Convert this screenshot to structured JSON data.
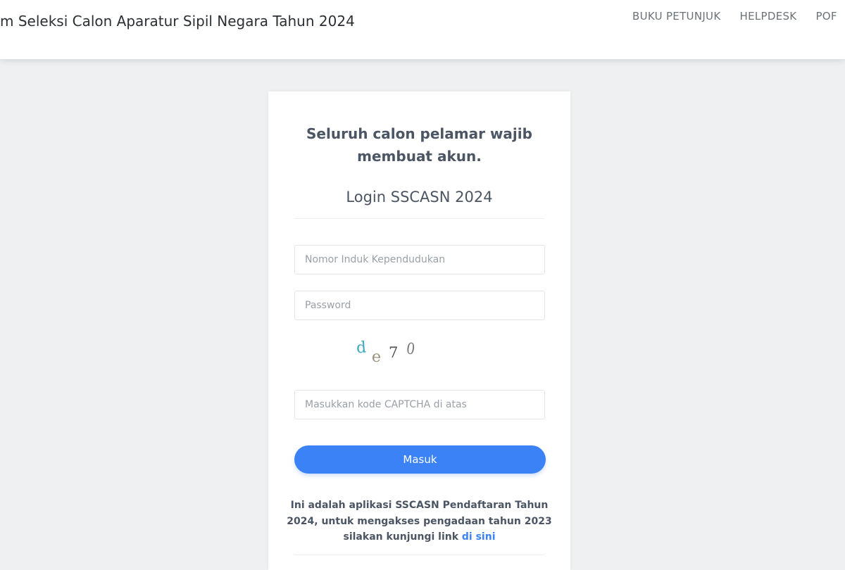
{
  "header": {
    "title": "m Seleksi Calon Aparatur Sipil Negara Tahun 2024",
    "nav": [
      {
        "label": "BUKU PETUNJUK"
      },
      {
        "label": "HELPDESK"
      },
      {
        "label": "POF"
      }
    ]
  },
  "login": {
    "headline_line1": "Seluruh calon pelamar wajib",
    "headline_line2": "membuat akun.",
    "subtitle": "Login SSCASN 2024",
    "nik_placeholder": "Nomor Induk Kependudukan",
    "password_placeholder": "Password",
    "captcha": {
      "chars": [
        {
          "char": "d",
          "color": "#3aa8c4"
        },
        {
          "char": "e",
          "color": "#9b8f7d"
        },
        {
          "char": "7",
          "color": "#555555"
        },
        {
          "char": "0",
          "color": "#777777"
        }
      ]
    },
    "captcha_placeholder": "Masukkan kode CAPTCHA di atas",
    "submit_label": "Masuk",
    "info_text": "Ini adalah aplikasi SSCASN Pendaftaran Tahun 2024, untuk mengakses pengadaan tahun 2023 silakan kunjungi link",
    "info_link": "di sini"
  },
  "colors": {
    "accent": "#3b82f6",
    "background": "#eef0f2",
    "text": "#4b5563"
  }
}
